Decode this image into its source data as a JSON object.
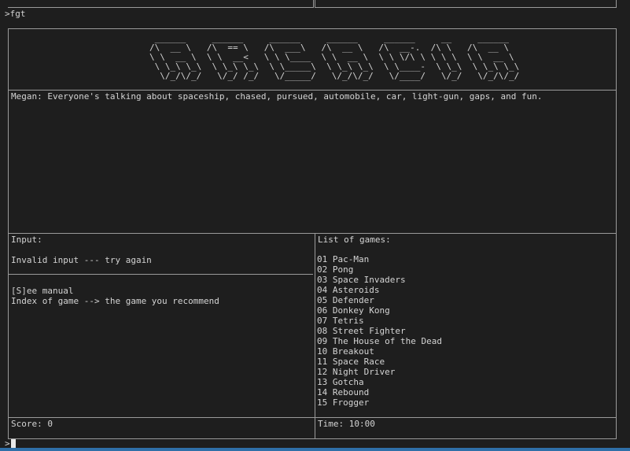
{
  "top_line": ">fgt",
  "prompt": ">",
  "title_art": " ______     ______     ______     ______     ______     __     ______\n/\\  __ \\   /\\  == \\   /\\  ___\\   /\\  __ \\   /\\  __-.  /\\ \\   /\\  __ \\\n\\ \\  __ \\  \\ \\  __<   \\ \\ \\____  \\ \\  __ \\  \\ \\ \\/\\ \\ \\ \\ \\  \\ \\  __ \\\n \\ \\_\\ \\_\\  \\ \\_\\ \\_\\  \\ \\_____\\  \\ \\_\\ \\_\\  \\ \\____-  \\ \\_\\  \\ \\_\\ \\_\\\n  \\/_/\\/_/   \\/_/ /_/   \\/_____/   \\/_/\\/_/   \\/____/   \\/_/   \\/_/\\/_/",
  "dialogue": "Megan: Everyone's talking about spaceship, chased, pursued, automobile, car, light-gun, gaps, and fun.",
  "input_panel": {
    "title": "Input:",
    "message": "Invalid input --- try again",
    "option_manual": "[S]ee manual",
    "option_index": "Index of game --> the game you recommend"
  },
  "games_panel": {
    "title": "List of games:",
    "games": [
      "01 Pac-Man",
      "02 Pong",
      "03 Space Invaders",
      "04 Asteroids",
      "05 Defender",
      "06 Donkey Kong",
      "07 Tetris",
      "08 Street Fighter",
      "09 The House of the Dead",
      "10 Breakout",
      "11 Space Race",
      "12 Night Driver",
      "13 Gotcha",
      "14 Rebound",
      "15 Frogger"
    ]
  },
  "score": "Score: 0",
  "time": "Time: 10:00",
  "colors": {
    "background": "#1e1e1e",
    "text": "#d4d4d4",
    "border": "#9a9a9a",
    "status_bar": "#2f6fa8"
  }
}
